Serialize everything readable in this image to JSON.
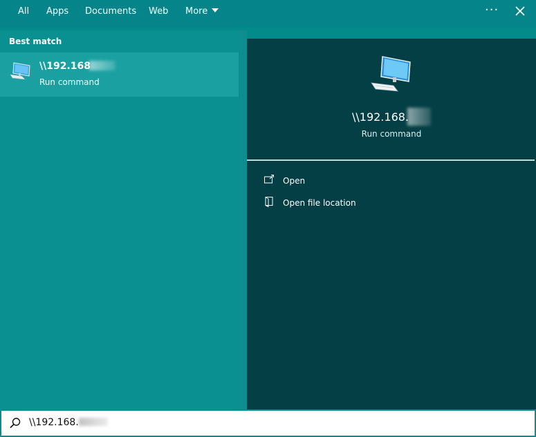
{
  "tabs": [
    "All",
    "Apps",
    "Documents",
    "Web",
    "More"
  ],
  "header": {
    "more_options_icon": "ellipsis-icon",
    "close_icon": "close-icon"
  },
  "left": {
    "section_label": "Best match",
    "result": {
      "title": "\\\\192.168",
      "subtitle": "Run command",
      "icon": "computer-icon"
    }
  },
  "preview": {
    "title": "\\\\192.168.",
    "subtitle": "Run command",
    "actions": [
      {
        "label": "Open",
        "icon": "open-icon"
      },
      {
        "label": "Open file location",
        "icon": "file-location-icon"
      }
    ]
  },
  "search": {
    "value": "\\\\192.168."
  },
  "colors": {
    "background": "#038a8a",
    "selected_result": "#1aa0a1",
    "preview_panel": "#043f45",
    "search_bg": "#ffffff"
  }
}
